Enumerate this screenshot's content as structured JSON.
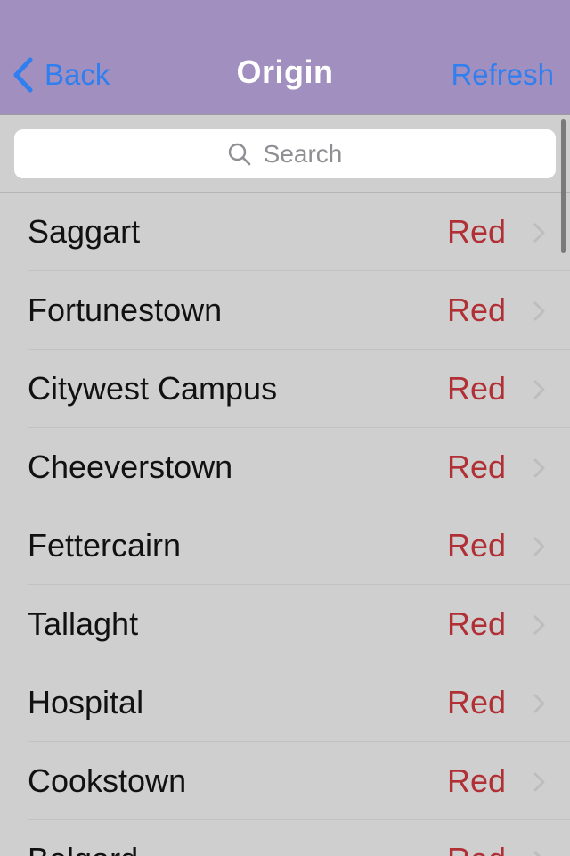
{
  "navbar": {
    "back_label": "Back",
    "title": "Origin",
    "refresh_label": "Refresh",
    "background_color": "#a08fbf",
    "tint_color": "#2f7ff0"
  },
  "search": {
    "placeholder": "Search",
    "icon": "search-icon"
  },
  "stops": {
    "line_color": "#b03036",
    "items": [
      {
        "name": "Saggart",
        "line": "Red"
      },
      {
        "name": "Fortunestown",
        "line": "Red"
      },
      {
        "name": "Citywest Campus",
        "line": "Red"
      },
      {
        "name": "Cheeverstown",
        "line": "Red"
      },
      {
        "name": "Fettercairn",
        "line": "Red"
      },
      {
        "name": "Tallaght",
        "line": "Red"
      },
      {
        "name": "Hospital",
        "line": "Red"
      },
      {
        "name": "Cookstown",
        "line": "Red"
      },
      {
        "name": "Belgard",
        "line": "Red"
      }
    ]
  }
}
